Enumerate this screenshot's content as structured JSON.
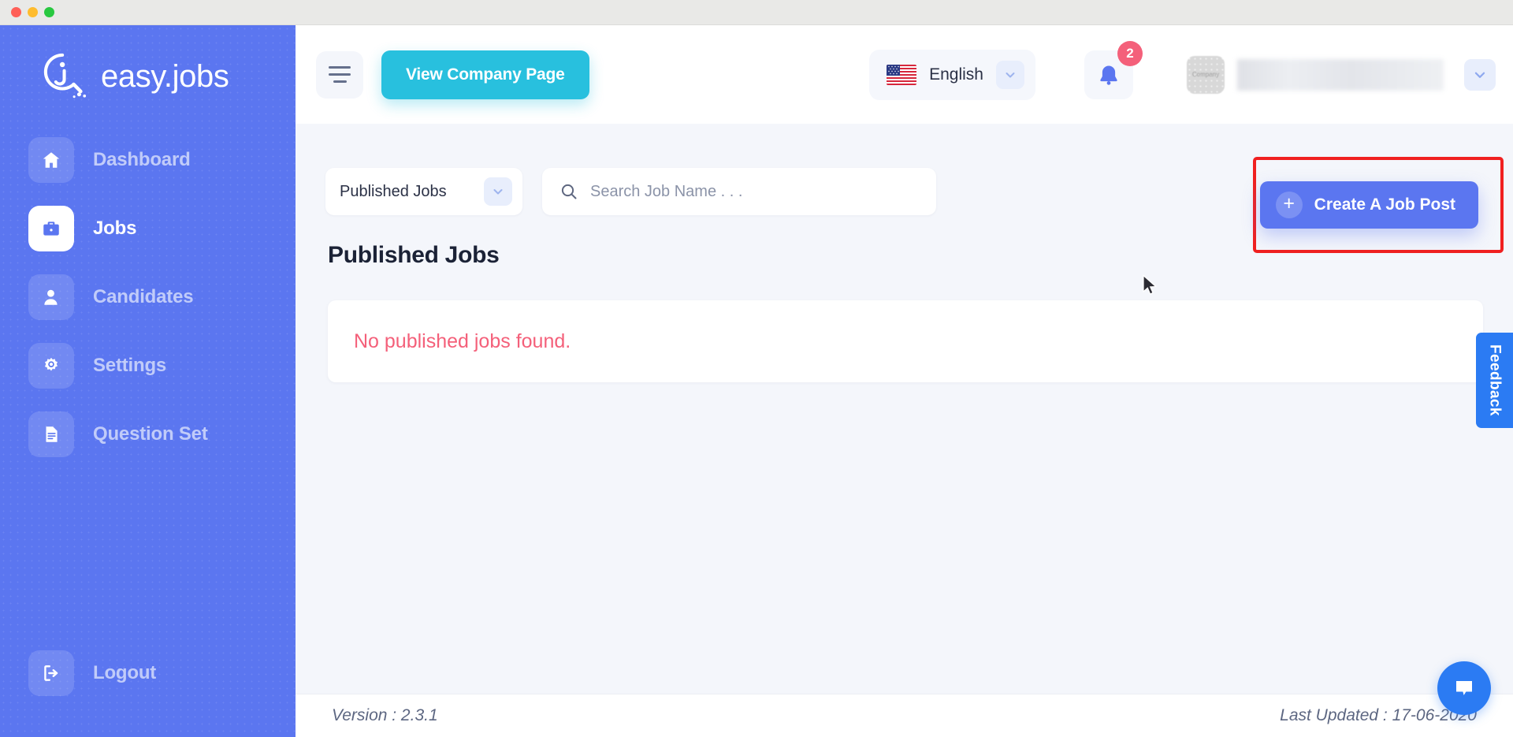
{
  "window": {
    "traffic_lights": [
      "close",
      "minimize",
      "zoom"
    ]
  },
  "sidebar": {
    "brand": "easy.jobs",
    "items": [
      {
        "label": "Dashboard",
        "icon": "home-icon",
        "active": false
      },
      {
        "label": "Jobs",
        "icon": "briefcase-icon",
        "active": true
      },
      {
        "label": "Candidates",
        "icon": "user-icon",
        "active": false
      },
      {
        "label": "Settings",
        "icon": "gear-icon",
        "active": false
      },
      {
        "label": "Question Set",
        "icon": "document-icon",
        "active": false
      }
    ],
    "logout": {
      "label": "Logout",
      "icon": "logout-icon"
    },
    "bg_color": "#5b76f0"
  },
  "header": {
    "menu_toggle_icon": "hamburger-icon",
    "view_company_label": "View Company Page",
    "view_company_color": "#28c0de",
    "language": {
      "selected": "English",
      "flag": "us-flag-icon",
      "chevron": "chevron-down-icon"
    },
    "notifications": {
      "icon": "bell-icon",
      "count": "2",
      "badge_color": "#f4607a"
    },
    "user": {
      "avatar_label": "Company",
      "name_redacted": true,
      "chevron": "chevron-down-icon"
    }
  },
  "toolbar": {
    "filter": {
      "selected": "Published Jobs",
      "chevron": "chevron-down-icon"
    },
    "search": {
      "placeholder": "Search Job Name . . .",
      "value": "",
      "icon": "search-icon"
    },
    "create_button": {
      "label": "Create A Job Post",
      "icon": "plus-icon",
      "color": "#5b76f0",
      "highlight_color": "#f02020"
    }
  },
  "main": {
    "section_title": "Published Jobs",
    "empty_message": "No published jobs found.",
    "empty_message_color": "#f4607a"
  },
  "footer": {
    "version": "Version : 2.3.1",
    "last_updated": "Last Updated : 17-06-2020"
  },
  "widgets": {
    "feedback_label": "Feedback",
    "feedback_color": "#2b7bf3",
    "chat_icon": "chat-bubble-icon"
  }
}
